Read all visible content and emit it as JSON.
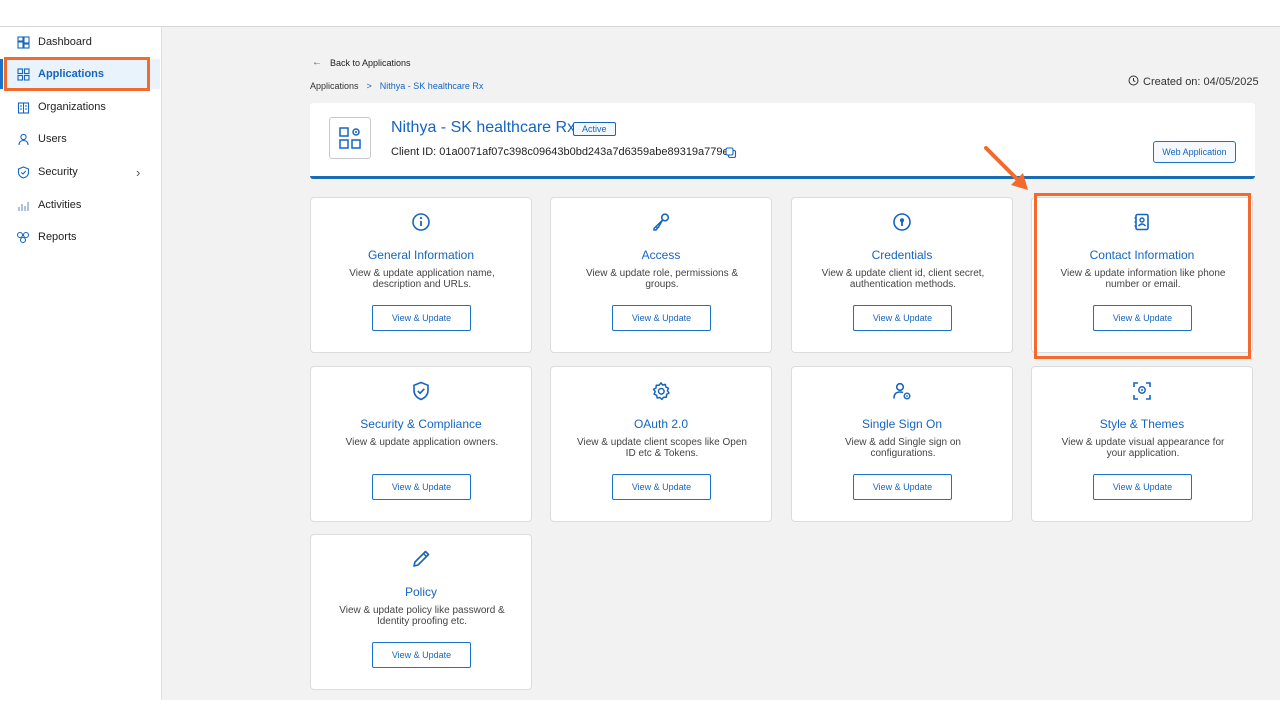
{
  "colors": {
    "accent": "#1565c0",
    "highlight": "#f26a2e",
    "background": "#f2f2f2"
  },
  "sidebar": {
    "items": [
      {
        "label": "Dashboard",
        "icon": "dashboard-icon"
      },
      {
        "label": "Applications",
        "icon": "applications-grid-icon",
        "active": true
      },
      {
        "label": "Organizations",
        "icon": "organization-icon"
      },
      {
        "label": "Users",
        "icon": "user-icon"
      },
      {
        "label": "Security",
        "icon": "shield-icon",
        "chevron": "›"
      },
      {
        "label": "Activities",
        "icon": "activity-bars-icon"
      },
      {
        "label": "Reports",
        "icon": "reports-icon"
      }
    ]
  },
  "page": {
    "back_label": "Back to Applications",
    "breadcrumb": {
      "root": "Applications",
      "separator": ">",
      "current": "Nithya - SK healthcare Rx"
    },
    "created_on": "Created on: 04/05/2025"
  },
  "app": {
    "name": "Nithya - SK healthcare Rx",
    "status": "Active",
    "client_id": "Client ID: 01a0071af07c398c09643b0bd243a7d6359abe89319a779e",
    "type_button": "Web Application"
  },
  "cards": [
    {
      "title": "General Information",
      "description": "View & update application name, description and URLs.",
      "button": "View & Update",
      "icon": "info-icon"
    },
    {
      "title": "Access",
      "description": "View & update role, permissions & groups.",
      "button": "View & Update",
      "icon": "key-icon"
    },
    {
      "title": "Credentials",
      "description": "View & update client id, client secret, authentication methods.",
      "button": "View & Update",
      "icon": "keyhole-icon"
    },
    {
      "title": "Contact Information",
      "description": "View & update information like phone number or email.",
      "button": "View & Update",
      "icon": "contact-book-icon"
    },
    {
      "title": "Security & Compliance",
      "description": "View & update application owners.",
      "button": "View & Update",
      "icon": "shield-check-icon"
    },
    {
      "title": "OAuth 2.0",
      "description": "View & update client scopes like Open ID etc & Tokens.",
      "button": "View & Update",
      "icon": "gear-icon"
    },
    {
      "title": "Single Sign On",
      "description": "View & add Single sign on configurations.",
      "button": "View & Update",
      "icon": "user-settings-icon"
    },
    {
      "title": "Style & Themes",
      "description": "View & update visual appearance for your application.",
      "button": "View & Update",
      "icon": "face-scan-icon"
    },
    {
      "title": "Policy",
      "description": "View & update policy like password & Identity proofing etc.",
      "button": "View & Update",
      "icon": "pencil-icon"
    }
  ]
}
